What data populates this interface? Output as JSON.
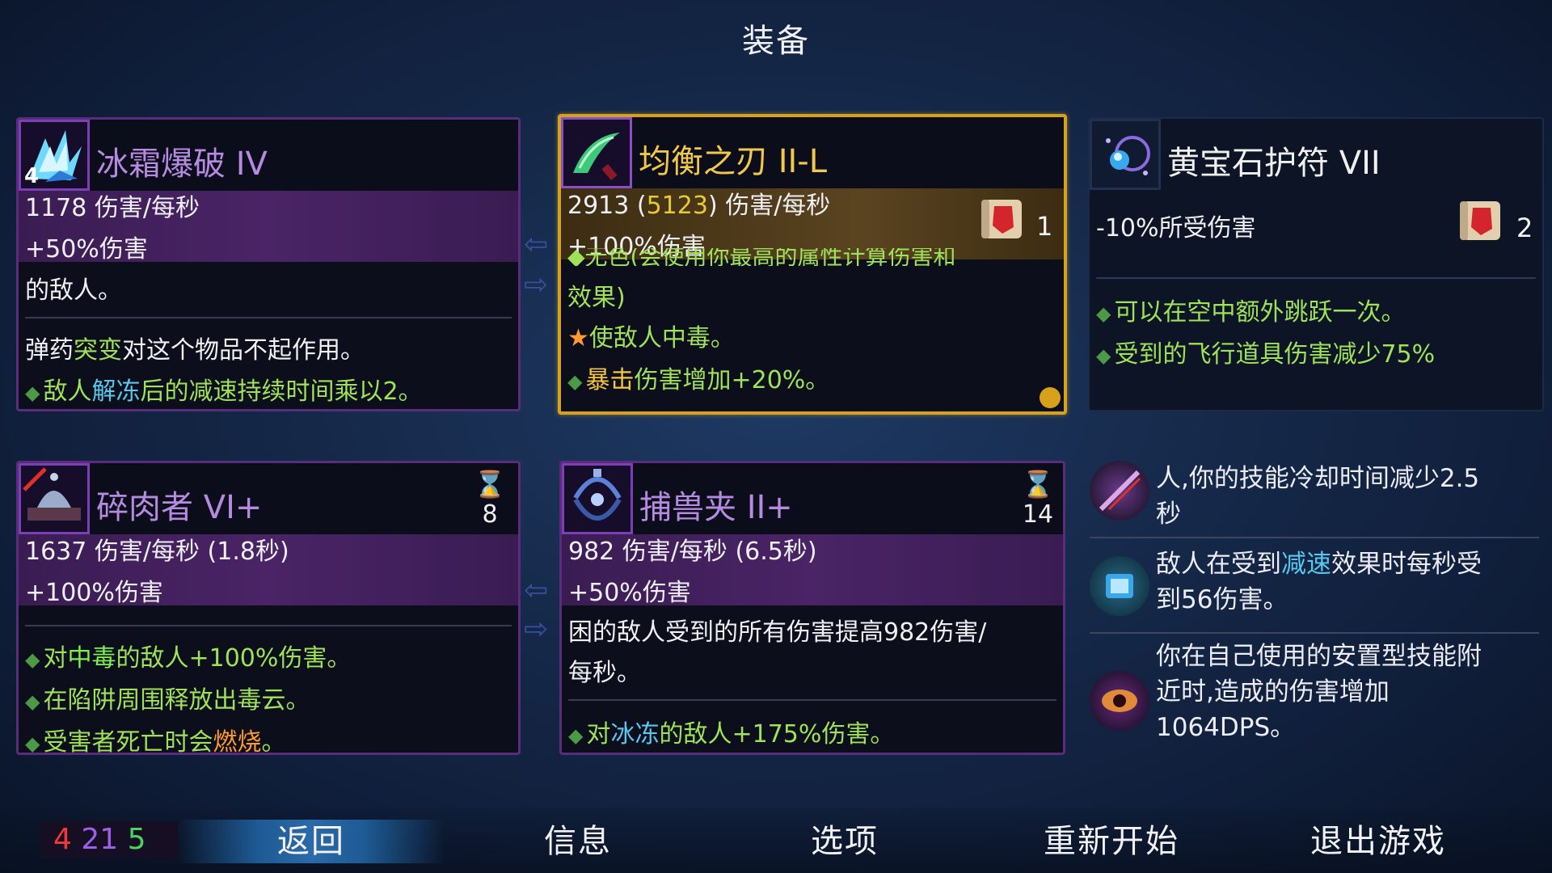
{
  "title": "装备",
  "cards": {
    "frost": {
      "icon_num": "4",
      "name": "冰霜爆破 IV",
      "stat1": "1178 伤害/每秒",
      "stat2": "+50%伤害",
      "desc": "的敌人。",
      "line_a_1": "弹药",
      "line_a_2": "突变",
      "line_a_3": "对这个物品不起作用。",
      "line_b_1": "敌人",
      "line_b_2": "解冻",
      "line_b_3": "后的减速持续时间乘以2。"
    },
    "balance": {
      "name": "均衡之刃 II-L",
      "stat1_a": "2913 (",
      "stat1_b": "5123",
      "stat1_c": ") 伤害/每秒",
      "stat2": "+100%伤害",
      "scroll_count": "1",
      "cut_line": "◆无色(会使用你最高的属性计算伤害和",
      "line1": "效果)",
      "line2_a": "使敌人",
      "line2_b": "中毒",
      "line2_c": "。",
      "line3_a": "暴击",
      "line3_b": "伤害增加+20%。"
    },
    "amulet": {
      "name": "黄宝石护符 VII",
      "stat1": "-10%所受伤害",
      "scroll_count": "2",
      "line1": "可以在空中额外跳跃一次。",
      "line2": "受到的飞行道具伤害减少75%"
    },
    "grinder": {
      "name": "碎肉者 VI+",
      "timer": "8",
      "stat1": "1637 伤害/每秒 (1.8秒)",
      "stat2": "+100%伤害",
      "line1_a": "对",
      "line1_b": "中毒",
      "line1_c": "的敌人+100%伤害。",
      "line2_a": "在陷阱周围释放出",
      "line2_b": "毒云",
      "line2_c": "。",
      "line3_a": "受害者死亡时会",
      "line3_b": "燃烧",
      "line3_c": "。"
    },
    "trap": {
      "name": "捕兽夹 II+",
      "timer": "14",
      "stat1": "982 伤害/每秒 (6.5秒)",
      "stat2": "+50%伤害",
      "desc1": "困的敌人受到的所有伤害提高982伤害/",
      "desc2": "每秒。",
      "line1_a": "对",
      "line1_b": "冰冻",
      "line1_c": "的敌人+175%伤害。"
    }
  },
  "mutations": [
    {
      "text1": "人,你的技能冷却时间减少2.5",
      "text2": "秒"
    },
    {
      "text1_a": "敌人在受到",
      "text1_b": "减速",
      "text1_c": "效果时每秒受",
      "text2": "到56伤害。"
    },
    {
      "text1": "你在自己使用的安置型技能附",
      "text2": "近时,造成的伤害增加",
      "text3": "1064DPS。"
    }
  ],
  "bottom": {
    "stats": {
      "red": "4",
      "purple": "21",
      "green": "5"
    },
    "menu": [
      "返回",
      "信息",
      "选项",
      "重新开始",
      "退出游戏"
    ]
  },
  "colors": {
    "brutality": "#ef3a3a",
    "tactics": "#9d5ee8",
    "survival": "#48d45e",
    "legendary_border": "#d6a21c"
  }
}
